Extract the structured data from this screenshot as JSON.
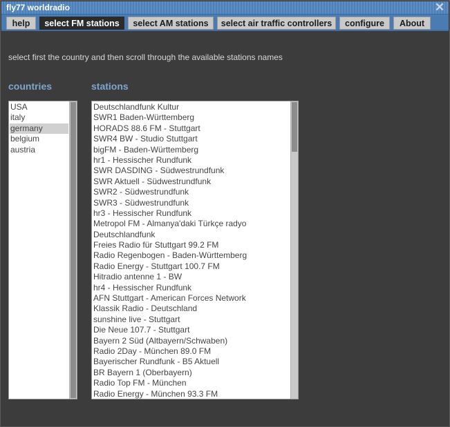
{
  "window": {
    "title": "fly77 worldradio",
    "close_glyph": "✕"
  },
  "tabs": [
    {
      "label": "help",
      "active": false
    },
    {
      "label": "select FM stations",
      "active": true
    },
    {
      "label": "select AM stations",
      "active": false
    },
    {
      "label": "select air traffic controllers",
      "active": false
    },
    {
      "label": "configure",
      "active": false
    },
    {
      "label": "About",
      "active": false
    }
  ],
  "instruction": "select first the country and then scroll through the available stations names",
  "countries": {
    "heading": "countries",
    "selected": "germany",
    "items": [
      "USA",
      "italy",
      "germany",
      "belgium",
      "austria"
    ]
  },
  "stations": {
    "heading": "stations",
    "scroll_fraction": 0.0,
    "items": [
      "Deutschlandfunk Kultur",
      "SWR1 Baden-Württemberg",
      "HORADS 88.6 FM - Stuttgart",
      "SWR4 BW - Studio Stuttgart",
      "bigFM - Baden-Württemberg",
      "hr1 - Hessischer Rundfunk",
      "SWR DASDING - Südwestrundfunk",
      "SWR Aktuell - Südwestrundfunk",
      "SWR2 - Südwestrundfunk",
      "SWR3 - Südwestrundfunk",
      "hr3 - Hessischer Rundfunk",
      "Metropol FM - Almanya'daki Türkçe radyo",
      "Deutschlandfunk",
      "Freies Radio für Stuttgart 99.2 FM",
      "Radio Regenbogen - Baden-Württemberg",
      "Radio Energy - Stuttgart 100.7 FM",
      "Hitradio antenne 1 - BW",
      "hr4 - Hessischer Rundfunk",
      "AFN Stuttgart - American Forces Network",
      "Klassik Radio - Deutschland",
      "sunshine live - Stuttgart",
      "Die Neue 107.7 - Stuttgart",
      "Bayern 2 Süd (Altbayern/Schwaben)",
      "Radio 2Day - München 89.0 FM",
      "Bayerischer Rundfunk - B5 Aktuell",
      "BR Bayern 1 (Oberbayern)",
      "Radio Top FM - München",
      "Radio Energy - München 93.3 FM"
    ]
  }
}
